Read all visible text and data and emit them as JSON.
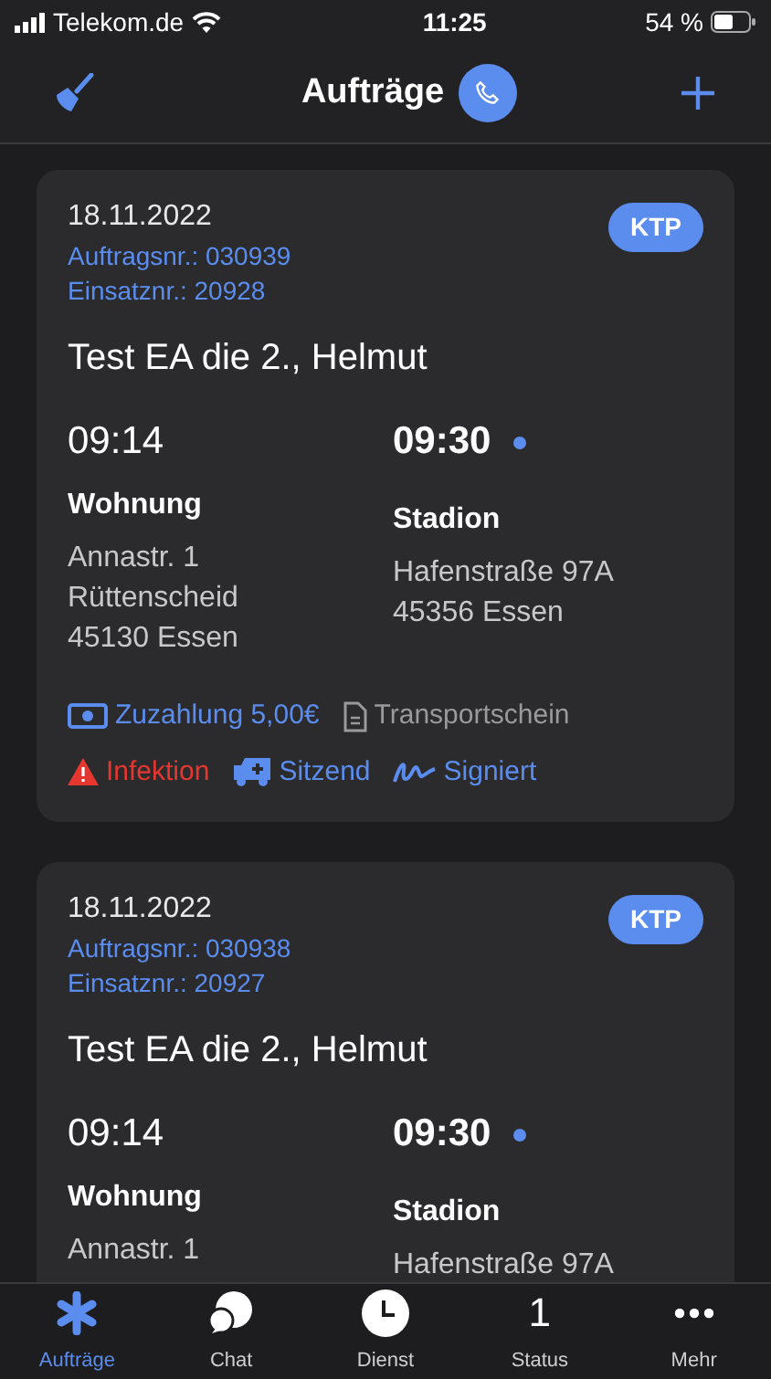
{
  "status_bar": {
    "carrier": "Telekom.de",
    "time": "11:25",
    "battery": "54 %"
  },
  "header": {
    "title": "Aufträge"
  },
  "orders": [
    {
      "date": "18.11.2022",
      "badge": "KTP",
      "order_no": "Auftragsnr.: 030939",
      "mission_no": "Einsatznr.: 20928",
      "patient": "Test EA die 2., Helmut",
      "pickup": {
        "time": "09:14",
        "name": "Wohnung",
        "address": [
          "Annastr. 1",
          "Rüttenscheid",
          "45130 Essen"
        ]
      },
      "dropoff": {
        "time": "09:30",
        "name": "Stadion",
        "address": [
          "Hafenstraße 97A",
          "45356 Essen"
        ]
      },
      "tags": [
        [
          {
            "kind": "payment",
            "label": "Zuzahlung 5,00€"
          },
          {
            "kind": "document",
            "label": "Transportschein"
          }
        ],
        [
          {
            "kind": "infection",
            "label": "Infektion"
          },
          {
            "kind": "vehicle",
            "label": "Sitzend"
          },
          {
            "kind": "signature",
            "label": "Signiert"
          }
        ]
      ]
    },
    {
      "date": "18.11.2022",
      "badge": "KTP",
      "order_no": "Auftragsnr.: 030938",
      "mission_no": "Einsatznr.: 20927",
      "patient": "Test EA die 2., Helmut",
      "pickup": {
        "time": "09:14",
        "name": "Wohnung",
        "address": [
          "Annastr. 1"
        ]
      },
      "dropoff": {
        "time": "09:30",
        "name": "Stadion",
        "address": [
          "Hafenstraße 97A"
        ]
      }
    }
  ],
  "tab_bar": [
    {
      "kind": "asterisk",
      "label": "Aufträge",
      "selected": true
    },
    {
      "kind": "chat",
      "label": "Chat",
      "selected": false
    },
    {
      "kind": "clock",
      "label": "Dienst",
      "selected": false
    },
    {
      "kind": "count",
      "value": "1",
      "label": "Status",
      "selected": false
    },
    {
      "kind": "more",
      "label": "Mehr",
      "selected": false
    }
  ]
}
